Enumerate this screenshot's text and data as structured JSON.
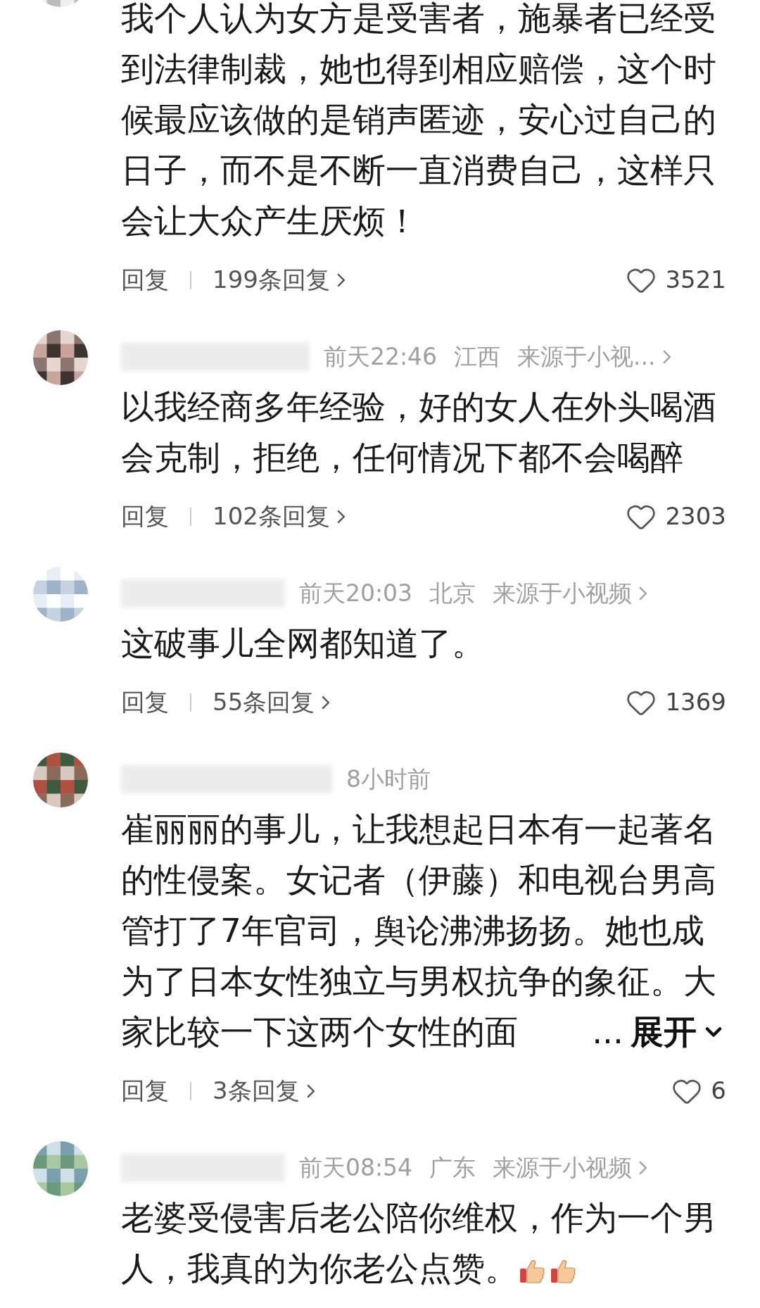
{
  "comments": [
    {
      "body": "我个人认为女方是受害者，施暴者已经受到法律制裁，她也得到相应赔偿，这个时候最应该做的是销声匿迹，安心过自己的日子，而不是不断一直消费自己，这样只会让大众产生厌烦！",
      "reply": "回复",
      "replies": "199条回复",
      "likes": "3521",
      "liked": false
    },
    {
      "time": "前天22:46",
      "location": "江西",
      "source": "来源于小视...",
      "body": "以我经商多年经验，好的女人在外头喝酒会克制，拒绝，任何情况下都不会喝醉",
      "reply": "回复",
      "replies": "102条回复",
      "likes": "2303",
      "liked": false
    },
    {
      "time": "前天20:03",
      "location": "北京",
      "source": "来源于小视频",
      "body": "这破事儿全网都知道了。",
      "reply": "回复",
      "replies": "55条回复",
      "likes": "1369",
      "liked": false
    },
    {
      "time": "8小时前",
      "body": "崔丽丽的事儿，让我想起日本有一起著名的性侵案。女记者（伊藤）和电视台男高管打了7年官司，舆论沸沸扬扬。她也成为了日本女性独立与男权抗争的象征。大家比较一下这两个女性的面",
      "expand": {
        "ellipsis": "...",
        "label": "展开"
      },
      "reply": "回复",
      "replies": "3条回复",
      "likes": "6",
      "liked": false
    },
    {
      "time": "前天08:54",
      "location": "广东",
      "source": "来源于小视频",
      "body": "老婆受侵害后老公陪你维权，作为一个男人，我真的为你老公点赞。",
      "emoji": [
        {
          "kind": "thumbs_up"
        },
        {
          "kind": "thumbs_up"
        }
      ]
    }
  ]
}
